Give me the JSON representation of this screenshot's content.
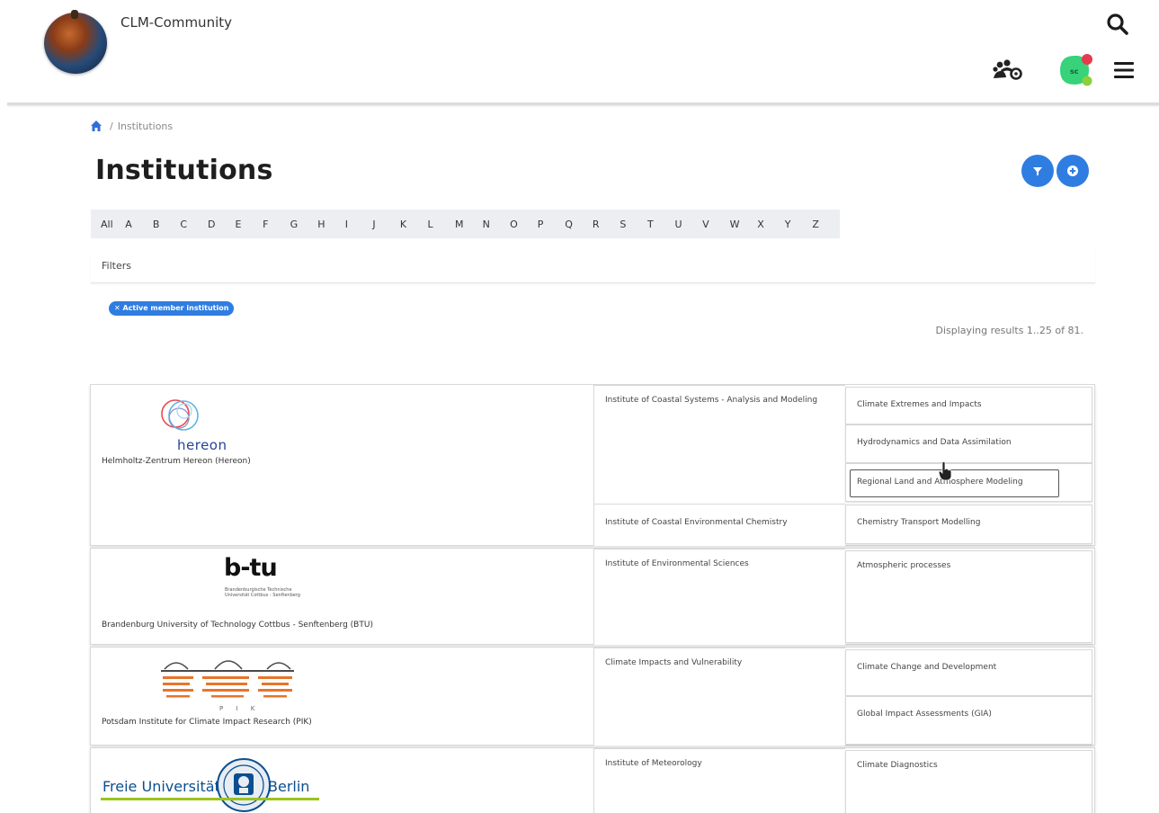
{
  "header": {
    "site_name": "CLM-Community",
    "icons": [
      "search-icon",
      "groups-icon",
      "avatar-icon",
      "menu-icon"
    ],
    "avatar_initials": "sc"
  },
  "breadcrumb": {
    "separator": "/",
    "current": "Institutions"
  },
  "page": {
    "title": "Institutions",
    "accent_color": "#2f7de1"
  },
  "alphabet": [
    "All",
    "A",
    "B",
    "C",
    "D",
    "E",
    "F",
    "G",
    "H",
    "I",
    "J",
    "K",
    "L",
    "M",
    "N",
    "O",
    "P",
    "Q",
    "R",
    "S",
    "T",
    "U",
    "V",
    "W",
    "X",
    "Y",
    "Z"
  ],
  "filters": {
    "label": "Filters",
    "active_chip": "✕ Active member institution"
  },
  "results_text": "Displaying results 1..25 of 81.",
  "institutions": [
    {
      "name": "Helmholtz-Zentrum Hereon (Hereon)",
      "logo_text": "hereon",
      "departments": [
        {
          "label": "Institute of Coastal Systems - Analysis and Modeling",
          "groups": [
            "Climate Extremes and Impacts",
            "Hydrodynamics and Data Assimilation",
            "Regional Land and Atmosphere Modeling"
          ]
        },
        {
          "label": "Institute of Coastal Environmental Chemistry",
          "groups": [
            "Chemistry Transport Modelling"
          ]
        }
      ]
    },
    {
      "name": "Brandenburg University of Technology Cottbus - Senftenberg (BTU)",
      "logo_text": "b-tu",
      "logo_subtext": "Brandenburgische Technische Universität Cottbus - Senftenberg",
      "departments": [
        {
          "label": "Institute of Environmental Sciences",
          "groups": [
            "Atmospheric processes"
          ]
        }
      ]
    },
    {
      "name": "Potsdam Institute for Climate Impact Research (PIK)",
      "logo_text": "P I K",
      "departments": [
        {
          "label": "Climate Impacts and Vulnerability",
          "groups": [
            "Climate Change and Development",
            "Global Impact Assessments (GIA)"
          ]
        }
      ]
    },
    {
      "name": "Freie Universität Berlin",
      "logo_left": "Freie Universität",
      "logo_right": "Berlin",
      "departments": [
        {
          "label": "Institute of Meteorology",
          "groups": [
            "Climate Diagnostics"
          ]
        }
      ]
    }
  ]
}
